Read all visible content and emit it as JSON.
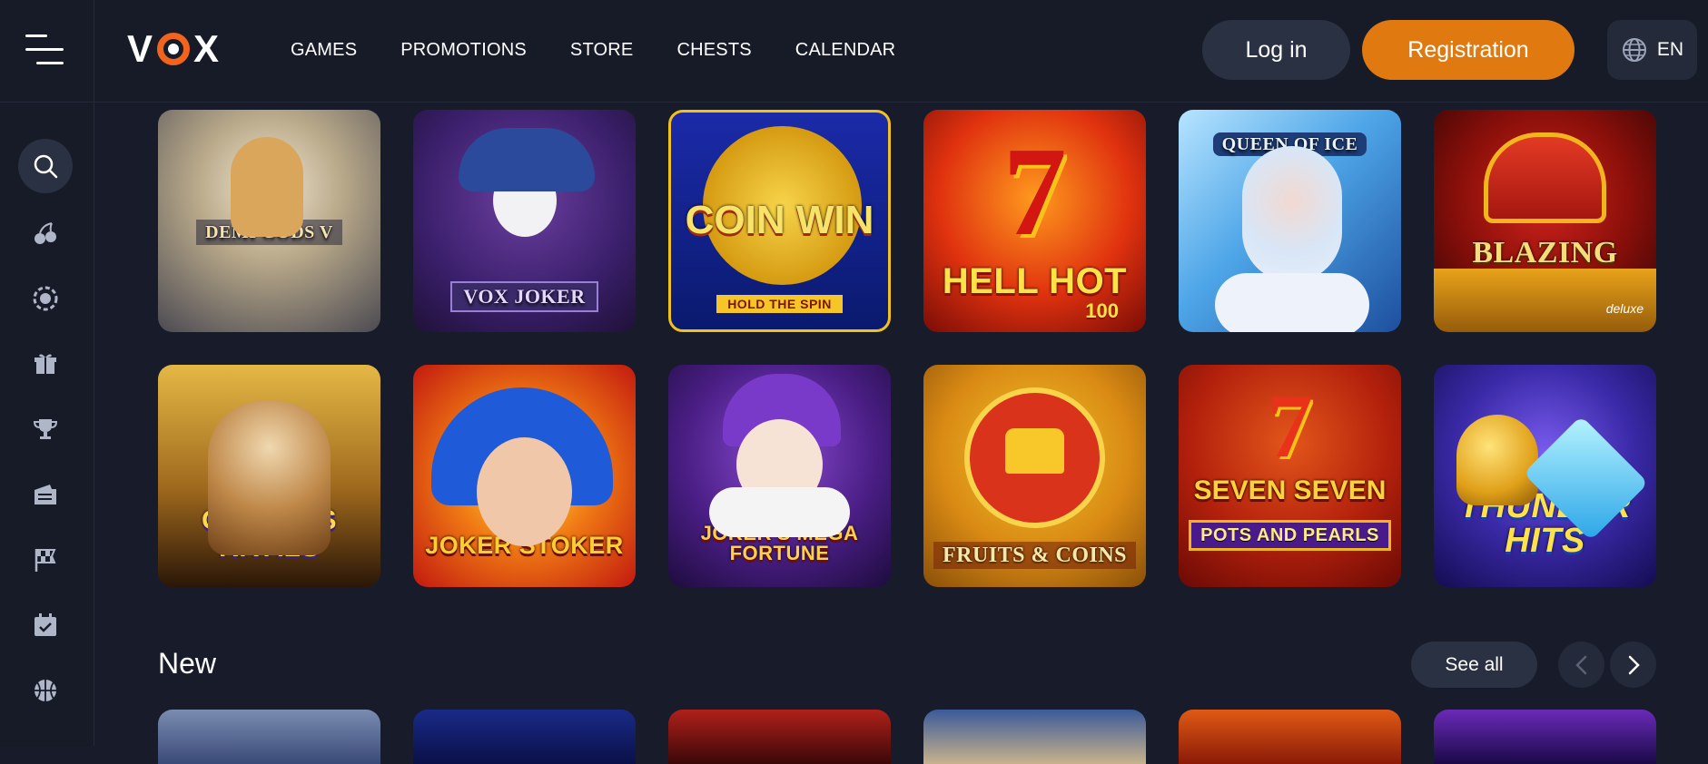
{
  "header": {
    "logo_text": "VOX",
    "nav": [
      "GAMES",
      "PROMOTIONS",
      "STORE",
      "CHESTS",
      "CALENDAR"
    ],
    "login_label": "Log in",
    "register_label": "Registration",
    "language": "EN"
  },
  "sidebar": {
    "items": [
      "search-icon",
      "cherries-icon",
      "chip-icon",
      "gift-icon",
      "trophy-icon",
      "ticket-icon",
      "flag-icon",
      "calendar-icon",
      "basketball-icon"
    ]
  },
  "games_row1": [
    {
      "title": "DEMI GODS V"
    },
    {
      "title": "VOX JOKER"
    },
    {
      "title": "COIN WIN",
      "subtitle": "HOLD THE SPIN"
    },
    {
      "title": "HELL HOT",
      "subtitle": "100"
    },
    {
      "title": "QUEEN OF ICE"
    },
    {
      "title": "BLAZING CROWN",
      "subtitle": "deluxe"
    }
  ],
  "games_row2": [
    {
      "title": "OLYMPUS RIVALS"
    },
    {
      "title": "JOKER STOKER"
    },
    {
      "title": "JOKER'S MEGA FORTUNE"
    },
    {
      "title": "FRUITS & COINS"
    },
    {
      "title": "SEVEN SEVEN",
      "subtitle": "POTS AND PEARLS"
    },
    {
      "title": "THUNDER HITS"
    }
  ],
  "new_section": {
    "title": "New",
    "see_all": "See all"
  },
  "colors": {
    "background": "#181c2a",
    "accent": "#e07a10",
    "button": "#2a3142"
  }
}
